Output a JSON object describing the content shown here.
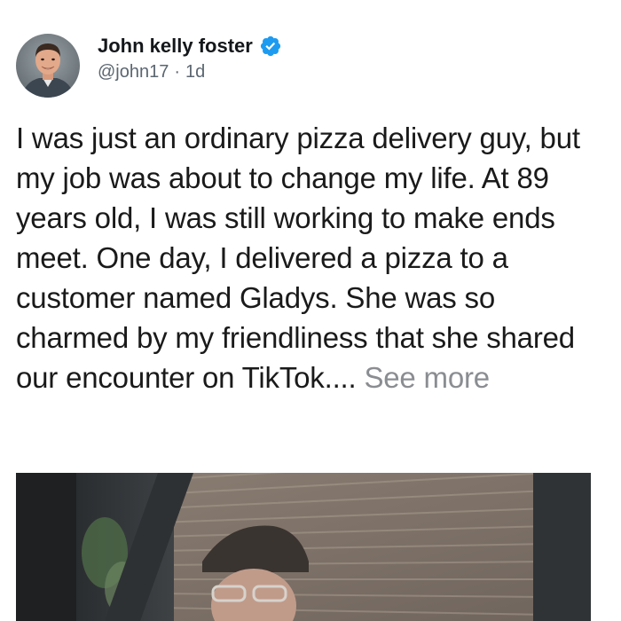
{
  "post": {
    "author": {
      "display_name": "John kelly foster",
      "handle": "@john17",
      "verified": true,
      "avatar_icon": "profile-photo"
    },
    "time_separator": "·",
    "time_ago": "1d",
    "text": "I was just an ordinary pizza delivery guy, but my job was about to change my life. At 89 years old, I was still working to make ends meet. One day, I delivered a pizza to a customer named Gladys. She was so charmed by my friendliness that she shared our encounter on TikTok....",
    "see_more_label": "See more",
    "media_icon": "video-thumbnail"
  },
  "colors": {
    "verified_badge": "#1d9bf0",
    "text": "#1a1a1a",
    "secondary_text": "#5b6670",
    "see_more": "#8a8d91"
  }
}
